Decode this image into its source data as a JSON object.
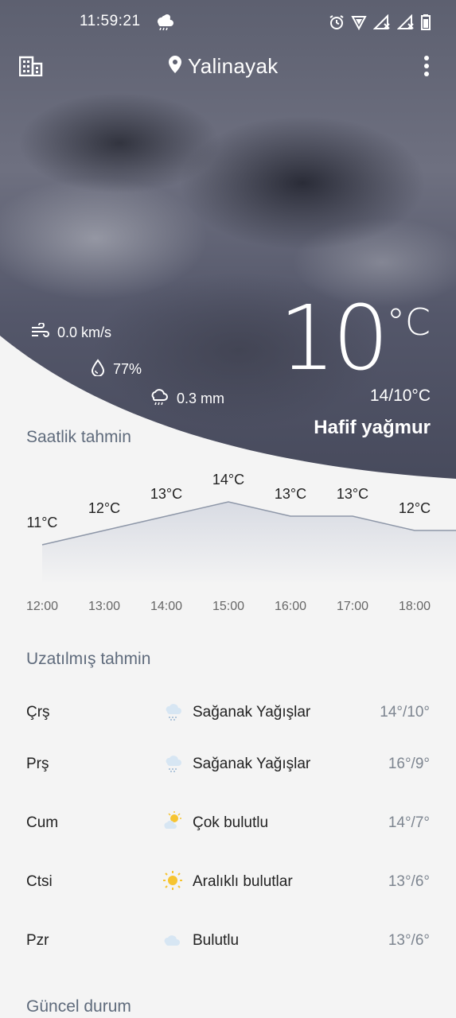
{
  "status_bar": {
    "time": "11:59:21"
  },
  "header": {
    "location": "Yalinayak"
  },
  "current": {
    "temperature": "10",
    "unit": "°C",
    "min_max": "14/10°C",
    "condition": "Hafif yağmur",
    "wind": "0.0 km/s",
    "humidity": "77%",
    "precipitation": "0.3 mm"
  },
  "hourly": {
    "title": "Saatlik tahmin",
    "times": [
      "12:00",
      "13:00",
      "14:00",
      "15:00",
      "16:00",
      "17:00",
      "18:00"
    ],
    "temps": [
      11,
      12,
      13,
      14,
      13,
      13,
      12
    ],
    "temp_labels": [
      "11°C",
      "12°C",
      "13°C",
      "14°C",
      "13°C",
      "13°C",
      "12°C"
    ]
  },
  "extended": {
    "title": "Uzatılmış tahmin",
    "days": [
      {
        "day": "Çrş",
        "icon": "rain-showers-icon",
        "desc": "Sağanak Yağışlar",
        "temps": "14°/10°"
      },
      {
        "day": "Prş",
        "icon": "rain-showers-icon",
        "desc": "Sağanak Yağışlar",
        "temps": "16°/9°"
      },
      {
        "day": "Cum",
        "icon": "partly-sunny-icon",
        "desc": "Çok bulutlu",
        "temps": "14°/7°"
      },
      {
        "day": "Ctsi",
        "icon": "sun-icon",
        "desc": "Aralıklı bulutlar",
        "temps": "13°/6°"
      },
      {
        "day": "Pzr",
        "icon": "cloud-icon",
        "desc": "Bulutlu",
        "temps": "13°/6°"
      }
    ]
  },
  "current_conditions": {
    "title": "Güncel durum"
  },
  "colors": {
    "accent_text": "#5f6b7c",
    "chart_line": "#8e97a8",
    "chart_fill": "#e2e4ea"
  }
}
